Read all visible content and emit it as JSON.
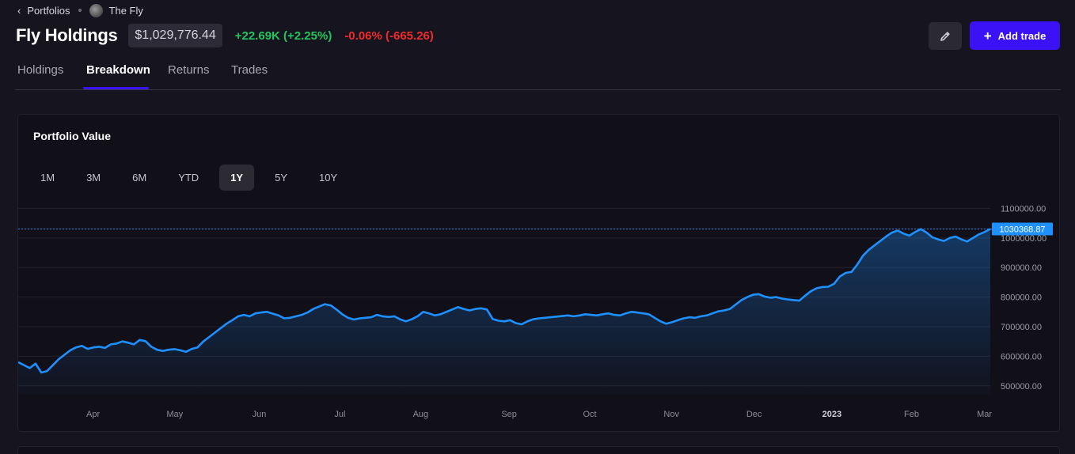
{
  "breadcrumb": {
    "back_icon": "chevron-left-icon",
    "portfolios": "Portfolios",
    "owner": "The Fly"
  },
  "header": {
    "title": "Fly Holdings",
    "value": "$1,029,776.44",
    "change_abs": "+22.69K (+2.25%)",
    "change_day": "-0.06% (-665.26)",
    "edit_icon": "pencil-icon",
    "add_trade_label": "Add trade"
  },
  "tabs": [
    {
      "label": "Holdings",
      "active": false
    },
    {
      "label": "Breakdown",
      "active": true
    },
    {
      "label": "Returns",
      "active": false
    },
    {
      "label": "Trades",
      "active": false
    }
  ],
  "card": {
    "title": "Portfolio Value",
    "ranges": [
      {
        "label": "1M",
        "active": false
      },
      {
        "label": "3M",
        "active": false
      },
      {
        "label": "6M",
        "active": false
      },
      {
        "label": "YTD",
        "active": false
      },
      {
        "label": "1Y",
        "active": true
      },
      {
        "label": "5Y",
        "active": false
      },
      {
        "label": "10Y",
        "active": false
      }
    ]
  },
  "colors": {
    "accent": "#3a12f5",
    "line": "#1e90ff",
    "positive": "#22c55e",
    "negative": "#ef2b2b"
  },
  "chart_data": {
    "type": "area",
    "ylim": [
      470000,
      1120000
    ],
    "y_ticks": [
      "1100000.00",
      "1000000.00",
      "900000.00",
      "800000.00",
      "700000.00",
      "600000.00",
      "500000.00"
    ],
    "y_tick_values": [
      1100000,
      1000000,
      900000,
      800000,
      700000,
      600000,
      500000
    ],
    "x_labels": [
      {
        "label": "Apr",
        "t": 0.077,
        "bold": false
      },
      {
        "label": "May",
        "t": 0.161,
        "bold": false
      },
      {
        "label": "Jun",
        "t": 0.248,
        "bold": false
      },
      {
        "label": "Jul",
        "t": 0.331,
        "bold": false
      },
      {
        "label": "Aug",
        "t": 0.414,
        "bold": false
      },
      {
        "label": "Sep",
        "t": 0.505,
        "bold": false
      },
      {
        "label": "Oct",
        "t": 0.588,
        "bold": false
      },
      {
        "label": "Nov",
        "t": 0.672,
        "bold": false
      },
      {
        "label": "Dec",
        "t": 0.757,
        "bold": false
      },
      {
        "label": "2023",
        "t": 0.837,
        "bold": true
      },
      {
        "label": "Feb",
        "t": 0.919,
        "bold": false
      },
      {
        "label": "Mar",
        "t": 0.994,
        "bold": false
      }
    ],
    "current_value": 1030368.87,
    "current_label": "1030368.87",
    "values": [
      580000,
      570000,
      560000,
      575000,
      545000,
      550000,
      570000,
      590000,
      605000,
      620000,
      630000,
      635000,
      625000,
      630000,
      632000,
      628000,
      640000,
      643000,
      650000,
      646000,
      640000,
      655000,
      651000,
      632000,
      622000,
      618000,
      622000,
      624000,
      620000,
      615000,
      625000,
      630000,
      650000,
      665000,
      680000,
      695000,
      710000,
      722000,
      735000,
      740000,
      735000,
      745000,
      748000,
      750000,
      744000,
      738000,
      728000,
      730000,
      735000,
      740000,
      748000,
      760000,
      768000,
      776000,
      772000,
      758000,
      742000,
      730000,
      724000,
      728000,
      730000,
      732000,
      740000,
      735000,
      733000,
      735000,
      725000,
      718000,
      725000,
      735000,
      750000,
      745000,
      738000,
      742000,
      750000,
      758000,
      766000,
      760000,
      755000,
      760000,
      762000,
      758000,
      726000,
      720000,
      718000,
      722000,
      712000,
      708000,
      718000,
      725000,
      728000,
      730000,
      732000,
      734000,
      736000,
      738000,
      735000,
      738000,
      742000,
      740000,
      738000,
      742000,
      745000,
      740000,
      738000,
      745000,
      750000,
      748000,
      745000,
      742000,
      730000,
      718000,
      710000,
      715000,
      722000,
      728000,
      732000,
      730000,
      735000,
      738000,
      745000,
      752000,
      755000,
      760000,
      775000,
      790000,
      800000,
      808000,
      810000,
      802000,
      798000,
      800000,
      795000,
      792000,
      790000,
      788000,
      805000,
      820000,
      830000,
      834000,
      835000,
      845000,
      870000,
      882000,
      885000,
      910000,
      940000,
      960000,
      975000,
      990000,
      1005000,
      1018000,
      1025000,
      1015000,
      1008000,
      1020000,
      1030000,
      1018000,
      1002000,
      995000,
      990000,
      1000000,
      1005000,
      995000,
      988000,
      1000000,
      1012000,
      1020000,
      1030369
    ]
  }
}
